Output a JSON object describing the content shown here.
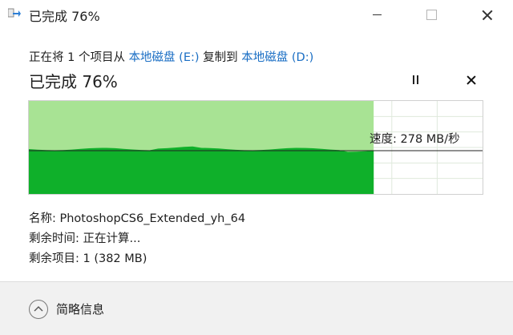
{
  "window": {
    "title": "已完成 76%",
    "icon": "copy-arrow-icon"
  },
  "copy_line": {
    "prefix": "正在将 1 个项目从 ",
    "source": "本地磁盘 (E:)",
    "middle": " 复制到 ",
    "destination": "本地磁盘 (D:)"
  },
  "status": {
    "title": "已完成 76%",
    "progress_fraction": 0.76
  },
  "speed": {
    "label": "速度: 278 MB/秒"
  },
  "details": {
    "name": "名称: PhotoshopCS6_Extended_yh_64",
    "time_remaining": "剩余时间: 正在计算...",
    "items_remaining": "剩余项目: 1 (382 MB)"
  },
  "footer": {
    "toggle_label": "简略信息"
  },
  "colors": {
    "progress_light": "#a8e394",
    "progress_dark": "#0fb02a",
    "link": "#1a6ec4",
    "grid": "#dfe9dc"
  }
}
